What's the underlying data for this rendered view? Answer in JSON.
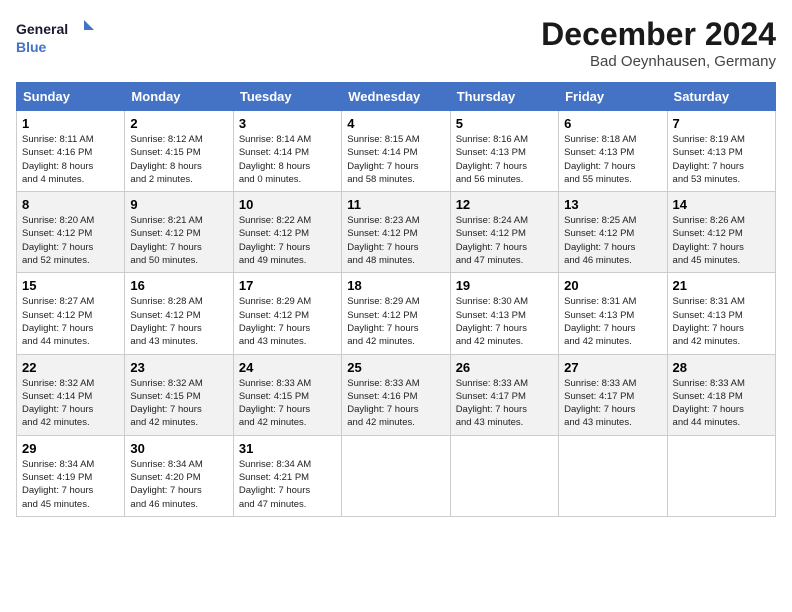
{
  "logo": {
    "line1": "General",
    "line2": "Blue"
  },
  "title": "December 2024",
  "subtitle": "Bad Oeynhausen, Germany",
  "weekdays": [
    "Sunday",
    "Monday",
    "Tuesday",
    "Wednesday",
    "Thursday",
    "Friday",
    "Saturday"
  ],
  "weeks": [
    [
      {
        "day": "1",
        "info": "Sunrise: 8:11 AM\nSunset: 4:16 PM\nDaylight: 8 hours\nand 4 minutes."
      },
      {
        "day": "2",
        "info": "Sunrise: 8:12 AM\nSunset: 4:15 PM\nDaylight: 8 hours\nand 2 minutes."
      },
      {
        "day": "3",
        "info": "Sunrise: 8:14 AM\nSunset: 4:14 PM\nDaylight: 8 hours\nand 0 minutes."
      },
      {
        "day": "4",
        "info": "Sunrise: 8:15 AM\nSunset: 4:14 PM\nDaylight: 7 hours\nand 58 minutes."
      },
      {
        "day": "5",
        "info": "Sunrise: 8:16 AM\nSunset: 4:13 PM\nDaylight: 7 hours\nand 56 minutes."
      },
      {
        "day": "6",
        "info": "Sunrise: 8:18 AM\nSunset: 4:13 PM\nDaylight: 7 hours\nand 55 minutes."
      },
      {
        "day": "7",
        "info": "Sunrise: 8:19 AM\nSunset: 4:13 PM\nDaylight: 7 hours\nand 53 minutes."
      }
    ],
    [
      {
        "day": "8",
        "info": "Sunrise: 8:20 AM\nSunset: 4:12 PM\nDaylight: 7 hours\nand 52 minutes."
      },
      {
        "day": "9",
        "info": "Sunrise: 8:21 AM\nSunset: 4:12 PM\nDaylight: 7 hours\nand 50 minutes."
      },
      {
        "day": "10",
        "info": "Sunrise: 8:22 AM\nSunset: 4:12 PM\nDaylight: 7 hours\nand 49 minutes."
      },
      {
        "day": "11",
        "info": "Sunrise: 8:23 AM\nSunset: 4:12 PM\nDaylight: 7 hours\nand 48 minutes."
      },
      {
        "day": "12",
        "info": "Sunrise: 8:24 AM\nSunset: 4:12 PM\nDaylight: 7 hours\nand 47 minutes."
      },
      {
        "day": "13",
        "info": "Sunrise: 8:25 AM\nSunset: 4:12 PM\nDaylight: 7 hours\nand 46 minutes."
      },
      {
        "day": "14",
        "info": "Sunrise: 8:26 AM\nSunset: 4:12 PM\nDaylight: 7 hours\nand 45 minutes."
      }
    ],
    [
      {
        "day": "15",
        "info": "Sunrise: 8:27 AM\nSunset: 4:12 PM\nDaylight: 7 hours\nand 44 minutes."
      },
      {
        "day": "16",
        "info": "Sunrise: 8:28 AM\nSunset: 4:12 PM\nDaylight: 7 hours\nand 43 minutes."
      },
      {
        "day": "17",
        "info": "Sunrise: 8:29 AM\nSunset: 4:12 PM\nDaylight: 7 hours\nand 43 minutes."
      },
      {
        "day": "18",
        "info": "Sunrise: 8:29 AM\nSunset: 4:12 PM\nDaylight: 7 hours\nand 42 minutes."
      },
      {
        "day": "19",
        "info": "Sunrise: 8:30 AM\nSunset: 4:13 PM\nDaylight: 7 hours\nand 42 minutes."
      },
      {
        "day": "20",
        "info": "Sunrise: 8:31 AM\nSunset: 4:13 PM\nDaylight: 7 hours\nand 42 minutes."
      },
      {
        "day": "21",
        "info": "Sunrise: 8:31 AM\nSunset: 4:13 PM\nDaylight: 7 hours\nand 42 minutes."
      }
    ],
    [
      {
        "day": "22",
        "info": "Sunrise: 8:32 AM\nSunset: 4:14 PM\nDaylight: 7 hours\nand 42 minutes."
      },
      {
        "day": "23",
        "info": "Sunrise: 8:32 AM\nSunset: 4:15 PM\nDaylight: 7 hours\nand 42 minutes."
      },
      {
        "day": "24",
        "info": "Sunrise: 8:33 AM\nSunset: 4:15 PM\nDaylight: 7 hours\nand 42 minutes."
      },
      {
        "day": "25",
        "info": "Sunrise: 8:33 AM\nSunset: 4:16 PM\nDaylight: 7 hours\nand 42 minutes."
      },
      {
        "day": "26",
        "info": "Sunrise: 8:33 AM\nSunset: 4:17 PM\nDaylight: 7 hours\nand 43 minutes."
      },
      {
        "day": "27",
        "info": "Sunrise: 8:33 AM\nSunset: 4:17 PM\nDaylight: 7 hours\nand 43 minutes."
      },
      {
        "day": "28",
        "info": "Sunrise: 8:33 AM\nSunset: 4:18 PM\nDaylight: 7 hours\nand 44 minutes."
      }
    ],
    [
      {
        "day": "29",
        "info": "Sunrise: 8:34 AM\nSunset: 4:19 PM\nDaylight: 7 hours\nand 45 minutes."
      },
      {
        "day": "30",
        "info": "Sunrise: 8:34 AM\nSunset: 4:20 PM\nDaylight: 7 hours\nand 46 minutes."
      },
      {
        "day": "31",
        "info": "Sunrise: 8:34 AM\nSunset: 4:21 PM\nDaylight: 7 hours\nand 47 minutes."
      },
      null,
      null,
      null,
      null
    ]
  ]
}
